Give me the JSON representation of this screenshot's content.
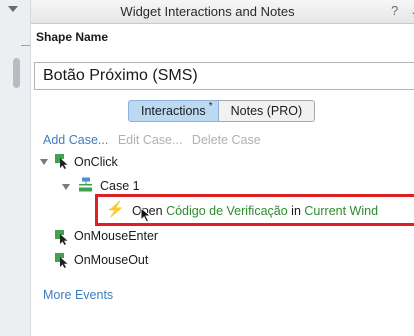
{
  "panel": {
    "title": "Widget Interactions and Notes",
    "help_label": "?",
    "more_label": "…"
  },
  "shape": {
    "label": "Shape Name",
    "value": "Botão Próximo (SMS)"
  },
  "tabs": [
    {
      "label": "Interactions",
      "marker": "*"
    },
    {
      "label": "Notes (PRO)"
    }
  ],
  "case_actions": {
    "add": "Add Case...",
    "edit": "Edit Case...",
    "delete": "Delete Case"
  },
  "tree": {
    "event_onclick": "OnClick",
    "case_name": "Case 1",
    "action": {
      "verb": "Open",
      "target": "Código de Verificação",
      "connector": "in",
      "location": "Current Wind"
    },
    "event_onmouseenter": "OnMouseEnter",
    "event_onmouseout": "OnMouseOut"
  },
  "more_events": "More Events",
  "colors": {
    "accent_link": "#3c7dbf",
    "tab_active": "#bcd9f4",
    "highlight_border": "#e01f22",
    "action_green": "#2e8b2e"
  }
}
